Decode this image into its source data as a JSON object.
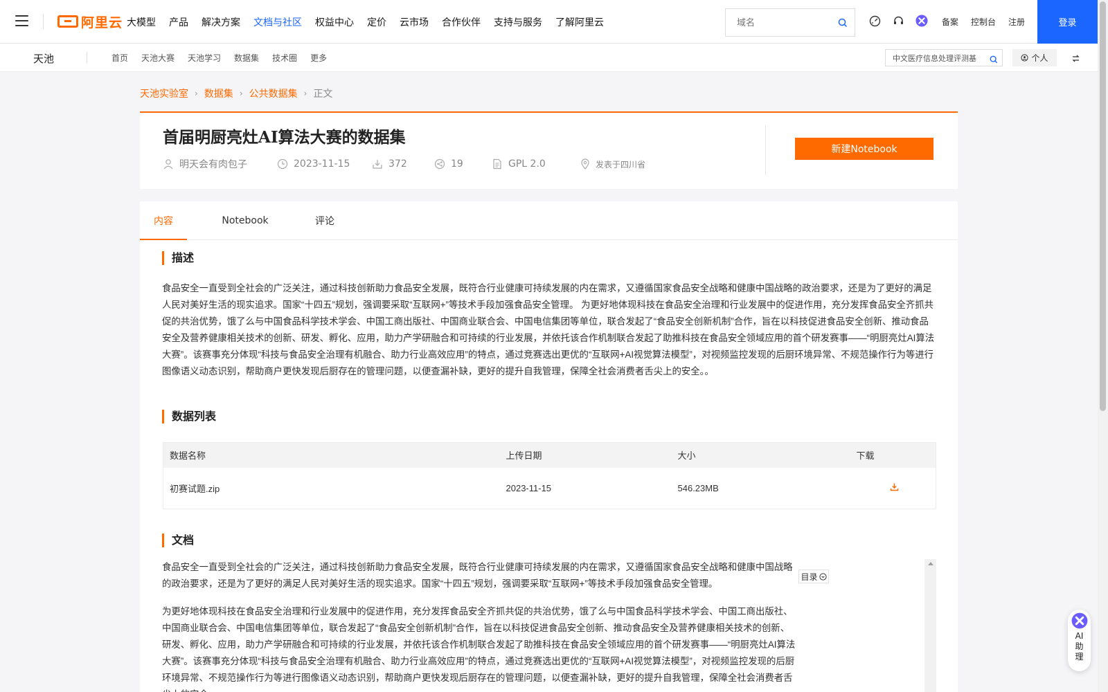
{
  "topnav": {
    "logo_text": "阿里云",
    "items": [
      "大模型",
      "产品",
      "解决方案",
      "文档与社区",
      "权益中心",
      "定价",
      "云市场",
      "合作伙伴",
      "支持与服务",
      "了解阿里云"
    ],
    "active_index": 3,
    "search_placeholder": "域名",
    "links": [
      "备案",
      "控制台",
      "注册"
    ],
    "login_label": "登录",
    "accent_color": "#1a66ff"
  },
  "subnav": {
    "brand": "天池",
    "items": [
      "首页",
      "天池大赛",
      "天池学习",
      "数据集",
      "技术圈",
      "更多"
    ],
    "search_value": "中文医疗信息处理评测基",
    "personal_label": "个人"
  },
  "breadcrumb": {
    "items": [
      "天池实验室",
      "数据集",
      "公共数据集",
      "正文"
    ]
  },
  "dataset": {
    "title": "首届明厨亮灶AI算法大赛的数据集",
    "author": "明天会有肉包子",
    "date": "2023-11-15",
    "downloads": "372",
    "shares": "19",
    "license": "GPL 2.0",
    "location": "发表于四川省",
    "new_notebook_label": "新建Notebook",
    "brand_color": "#ff6a00"
  },
  "tabs": [
    "内容",
    "Notebook",
    "评论"
  ],
  "description": {
    "title": "描述",
    "text": " 食品安全一直受到全社会的广泛关注，通过科技创新助力食品安全发展，既符合行业健康可持续发展的内在需求，又遵循国家食品安全战略和健康中国战略的政治要求，还是为了更好的满足人民对美好生活的现实追求。国家“十四五”规划，强调要采取“互联网+”等技术手段加强食品安全管理。 为更好地体现科技在食品安全治理和行业发展中的促进作用，充分发挥食品安全齐抓共促的共治优势，饿了么与中国食品科学技术学会、中国工商出版社、中国商业联合会、中国电信集团等单位，联合发起了“食品安全创新机制”合作，旨在以科技促进食品安全创新、推动食品安全及营养健康相关技术的创新、研发、孵化、应用，助力产学研融合和可持续的行业发展，并依托该合作机制联合发起了助推科技在食品安全领域应用的首个研发赛事——“明厨亮灶AI算法大赛”。该赛事充分体现“科技与食品安全治理有机融合、助力行业高效应用”的特点，通过竞赛选出更优的“互联网+AI视觉算法模型”，对视频监控发现的后厨环境异常、不规范操作行为等进行图像语义动态识别，帮助商户更快发现后厨存在的管理问题，以便查漏补缺，更好的提升自我管理，保障全社会消费者舌尖上的安全。。"
  },
  "data_list": {
    "title": "数据列表",
    "columns": [
      "数据名称",
      "上传日期",
      "大小",
      "下载"
    ],
    "rows": [
      {
        "name": "初赛试题.zip",
        "date": "2023-11-15",
        "size": "546.23MB"
      }
    ]
  },
  "docs": {
    "title": "文档",
    "toc_label": "目录",
    "paragraphs": [
      "食品安全一直受到全社会的广泛关注，通过科技创新助力食品安全发展，既符合行业健康可持续发展的内在需求，又遵循国家食品安全战略和健康中国战略的政治要求，还是为了更好的满足人民对美好生活的现实追求。国家“十四五”规划，强调要采取“互联网+”等技术手段加强食品安全管理。",
      "为更好地体现科技在食品安全治理和行业发展中的促进作用，充分发挥食品安全齐抓共促的共治优势，饿了么与中国食品科学技术学会、中国工商出版社、中国商业联合会、中国电信集团等单位，联合发起了“食品安全创新机制”合作，旨在以科技促进食品安全创新、推动食品安全及营养健康相关技术的创新、研发、孵化、应用，助力产学研融合和可持续的行业发展，并依托该合作机制联合发起了助推科技在食品安全领域应用的首个研发赛事——“明厨亮灶AI算法大赛”。该赛事充分体现“科技与食品安全治理有机融合、助力行业高效应用”的特点，通过竞赛选出更优的“互联网+AI视觉算法模型”，对视频监控发现的后厨环境异常、不规范操作行为等进行图像语义动态识别，帮助商户更快发现后厨存在的管理问题，以便查漏补缺，更好的提升自我管理，保障全社会消费者舌尖上的安全。"
    ]
  },
  "ai_assistant": {
    "label": "AI助理"
  }
}
